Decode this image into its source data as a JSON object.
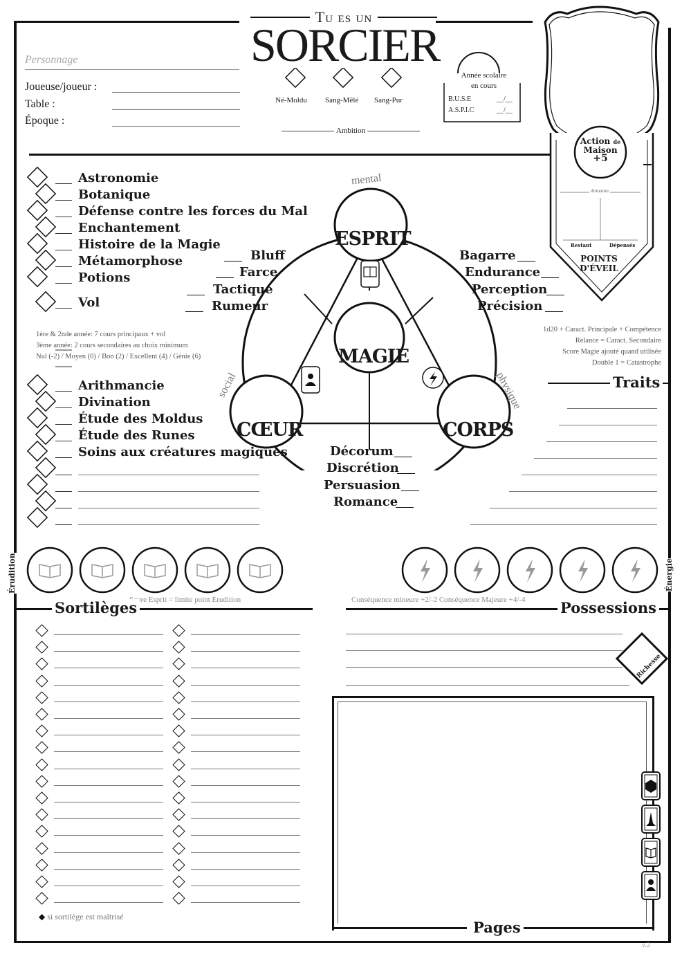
{
  "header": {
    "title_top": "Tu es un",
    "title_main": "SORCIER",
    "personnage_placeholder": "Personnage",
    "fields": [
      "Joueuse/joueur :",
      "Table :",
      "Époque :"
    ],
    "blood": [
      "Né-Moldu",
      "Sang-Mêlé",
      "Sang-Pur"
    ],
    "ambition": "Ambition",
    "school_year_1": "Année scolaire",
    "school_year_2": "en cours",
    "buse": "B.U.S.E",
    "aspic": "A.S.P.I.C",
    "exam_slot": "__/__"
  },
  "crest": {
    "action_1": "Action",
    "action_de": "de",
    "action_2": "Maison",
    "action_bonus": "+5",
    "domaine": "domaine",
    "restant": "Restant",
    "depenses": "Dépensés",
    "points_1": "POINTS",
    "points_2": "D'ÉVEIL"
  },
  "courses_main": [
    "Astronomie",
    "Botanique",
    "Défense contre les forces du Mal",
    "Enchantement",
    "Histoire de la Magie",
    "Métamorphose",
    "Potions",
    "Vol"
  ],
  "courses_secondary": [
    "Arithmancie",
    "Divination",
    "Étude des Moldus",
    "Étude des Runes",
    "Soins aux créatures magiques"
  ],
  "course_notes": [
    "1ère & 2nde année: 7 cours principaux + vol",
    "3ème année: 2 cours secondaires au choix minimum",
    "Nul (-2) / Moyen (0) / Bon (2) / Excellent (4) / Génie (6)"
  ],
  "rules_notes": [
    "1d20 + Caract. Principale + Compétence",
    "Relance = Caract. Secondaire",
    "Score Magie ajouté quand utilisée",
    "Double 1 = Catastrophe"
  ],
  "attributes": {
    "esprit": "ESPRIT",
    "magie": "MAGIE",
    "coeur": "CŒUR",
    "corps": "CORPS",
    "arc_mental": "mental",
    "arc_social": "social",
    "arc_physique": "physique"
  },
  "skills_esprit": [
    "Bluff",
    "Farce",
    "Tactique",
    "Rumeur"
  ],
  "skills_corps": [
    "Bagarre",
    "Endurance",
    "Perception",
    "Précision"
  ],
  "skills_coeur": [
    "Décorum",
    "Discrétion",
    "Persuasion",
    "Romance"
  ],
  "traits": "Traits",
  "erudition": "Érudition",
  "energie": "Énergie",
  "erudition_note": "Score Esprit = limite point Érudition",
  "energie_note": "Conséquence mineure +2/-2 Conséquence Majeure +4/-4",
  "sortileges": "Sortilèges",
  "possessions": "Possessions",
  "richesse": "Richesse",
  "sort_note": "si sortilège est maîtrisé",
  "pages": "Pages",
  "version": "v.2"
}
